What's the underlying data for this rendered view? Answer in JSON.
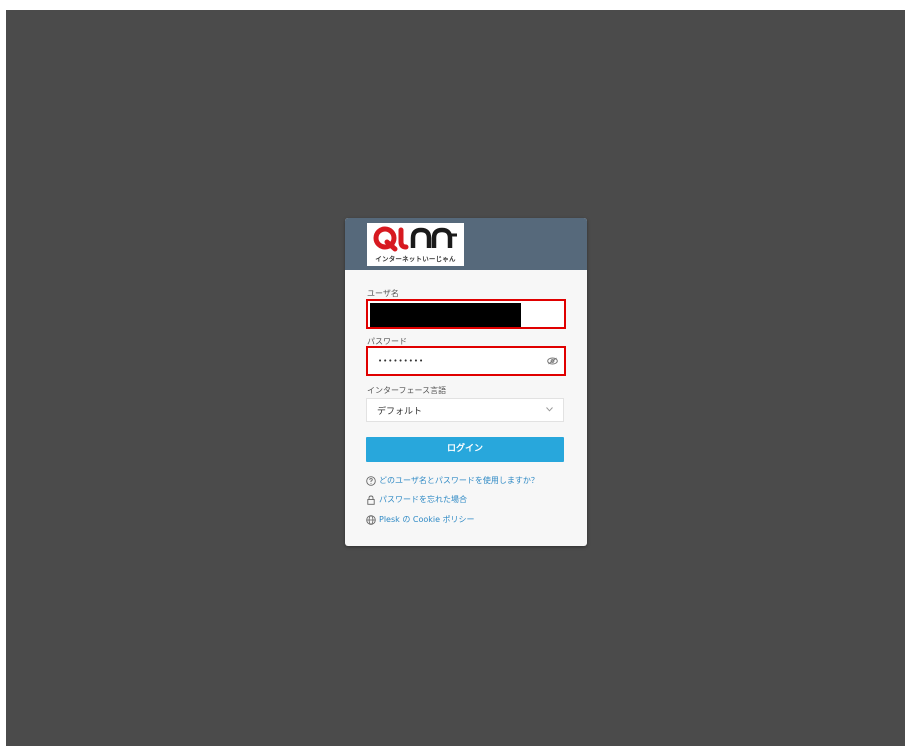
{
  "logo": {
    "brand": "QTAN",
    "tagline": "インターネットいーじゃん",
    "icon": "qtnet-logo"
  },
  "form": {
    "username": {
      "label": "ユーザ名",
      "value": ""
    },
    "password": {
      "label": "パスワード",
      "value": "•••••••••",
      "toggle_icon": "eye-icon"
    },
    "language": {
      "label": "インターフェース言語",
      "selected": "デフォルト"
    },
    "login_label": "ログイン"
  },
  "links": [
    {
      "icon": "question-circle-icon",
      "label": "どのユーザ名とパスワードを使用しますか？"
    },
    {
      "icon": "lock-icon",
      "label": "パスワードを忘れた場合"
    },
    {
      "icon": "globe-icon",
      "label": "Plesk の Cookie ポリシー"
    }
  ],
  "colors": {
    "backdrop": "#4b4b4b",
    "header": "#56697b",
    "accent": "#28a7dc",
    "highlight": "#e00000",
    "link": "#2f8ac5"
  }
}
